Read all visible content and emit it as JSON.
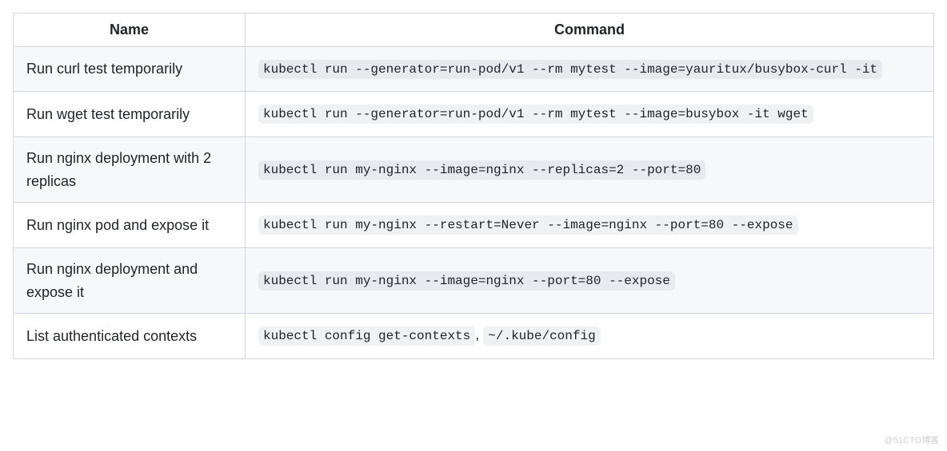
{
  "table": {
    "headers": {
      "name": "Name",
      "command": "Command"
    },
    "rows": [
      {
        "name": "Run curl test temporarily",
        "command": "kubectl run --generator=run-pod/v1 --rm mytest --image=yauritux/busybox-curl -it"
      },
      {
        "name": "Run wget test temporarily",
        "command": "kubectl run --generator=run-pod/v1 --rm mytest --image=busybox -it wget"
      },
      {
        "name": "Run nginx deployment with 2 replicas",
        "command": "kubectl run my-nginx --image=nginx --replicas=2 --port=80"
      },
      {
        "name": "Run nginx pod and expose it",
        "command": "kubectl run my-nginx --restart=Never --image=nginx --port=80 --expose"
      },
      {
        "name": "Run nginx deployment and expose it",
        "command": "kubectl run my-nginx --image=nginx --port=80 --expose"
      },
      {
        "name": "List authenticated contexts",
        "command": "kubectl config get-contexts",
        "extra": ", ",
        "command2": "~/.kube/config"
      }
    ]
  },
  "watermark": "@51CTO博客"
}
